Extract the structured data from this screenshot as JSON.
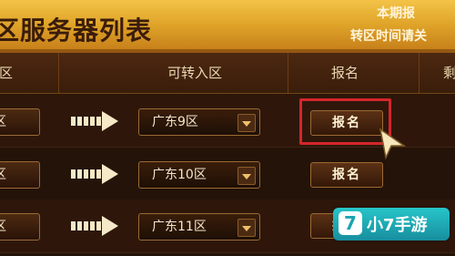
{
  "header": {
    "title": "区服务器列表",
    "notice_line1": "本期报",
    "notice_line2": "转区时间请关"
  },
  "table": {
    "columns": [
      "区",
      "可转入区",
      "报名",
      "剩"
    ],
    "rows": [
      {
        "source": "区",
        "target": "广东9区",
        "action": "报名"
      },
      {
        "source": "区",
        "target": "广东10区",
        "action": "报名"
      },
      {
        "source": "区",
        "target": "广东11区",
        "action": "报名"
      }
    ]
  },
  "watermark": {
    "mark": "7",
    "text": "小7手游"
  },
  "colors": {
    "header_gold": "#e0a52a",
    "highlight_red": "#d4262b",
    "logo_teal": "#1ba4b0"
  }
}
